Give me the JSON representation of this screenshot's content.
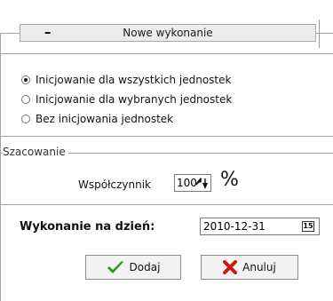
{
  "panel": {
    "collapse_symbol": "–",
    "title": "Nowe wykonanie"
  },
  "init_options": [
    {
      "label": "Inicjowanie dla wszystkich jednostek",
      "selected": true
    },
    {
      "label": "Inicjowanie dla wybranych jednostek",
      "selected": false
    },
    {
      "label": "Bez inicjowania jednostek",
      "selected": false
    }
  ],
  "estimation": {
    "section_label": "Szacowanie",
    "coefficient_label": "Współczynnik",
    "coefficient_value": "100",
    "unit": "%"
  },
  "execution": {
    "date_label": "Wykonanie na dzień:",
    "date_value": "2010-12-31",
    "calendar_icon_text": "15"
  },
  "buttons": {
    "add_label": "Dodaj",
    "cancel_label": "Anuluj"
  },
  "colors": {
    "check": "#2e9a12",
    "cancel_x": "#cc1a10",
    "frame": "#a5a5a5"
  },
  "icons": [
    "minus-icon",
    "spin-arrows-icon",
    "calendar-icon",
    "checkmark-icon",
    "x-icon"
  ]
}
